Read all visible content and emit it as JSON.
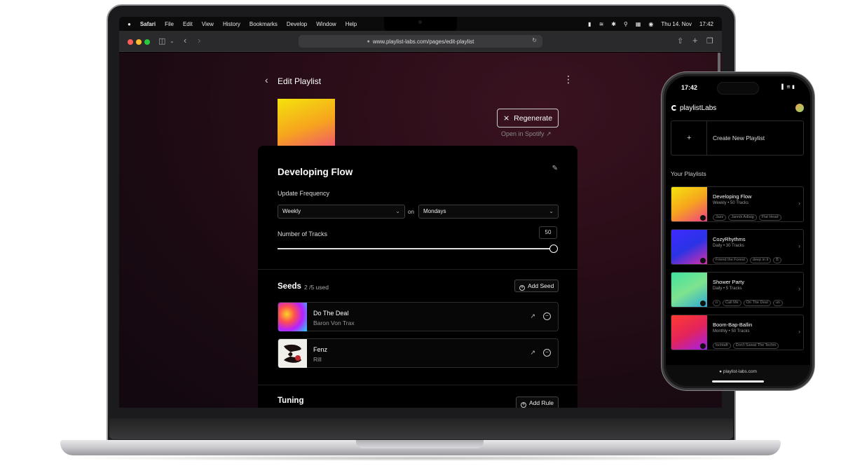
{
  "menubar": {
    "apple": "",
    "app": "Safari",
    "items": [
      "File",
      "Edit",
      "View",
      "History",
      "Bookmarks",
      "Develop",
      "Window",
      "Help"
    ],
    "status_icons": [
      "battery-icon",
      "wifi-icon",
      "bluetooth-icon",
      "search-icon",
      "control-center-icon",
      "siri-icon"
    ],
    "date": "Thu 14. Nov",
    "time": "17:42"
  },
  "browser": {
    "url": "www.playlist-labs.com/pages/edit-playlist"
  },
  "page": {
    "title": "Edit Playlist",
    "regenerate_label": "Regenerate",
    "open_spotify_label": "Open in Spotify",
    "playlist_name": "Developing Flow",
    "update_frequency_label": "Update Frequency",
    "frequency_value": "Weekly",
    "on_label": "on",
    "day_value": "Mondays",
    "tracks_label": "Number of Tracks",
    "tracks_value": "50",
    "tracks_fraction": 1.0,
    "seeds_title": "Seeds",
    "seeds_used": "2 /5 used",
    "add_seed_label": "Add Seed",
    "seeds": [
      {
        "title": "Do The Deal",
        "artist": "Baron Von Trax"
      },
      {
        "title": "Fenz",
        "artist": "Rill"
      }
    ],
    "tuning_title": "Tuning",
    "add_rule_label": "Add Rule"
  },
  "phone": {
    "time": "17:42",
    "brand": "playlistLabs",
    "create_label": "Create New Playlist",
    "create_plus": "+",
    "your_playlists_label": "Your Playlists",
    "playlists": [
      {
        "name": "Developing Flow",
        "meta": "Weekly • 50 Tracks",
        "tags": [
          "Jazz",
          "Jannik Adlaig",
          "Flat Head"
        ]
      },
      {
        "name": "CozyRhythms",
        "meta": "Daily • 30 Tracks",
        "tags": [
          "Friend the Forest",
          "deep in it",
          "B"
        ]
      },
      {
        "name": "Shower Party",
        "meta": "Daily • 5 Tracks",
        "tags": [
          "n",
          "Call Me",
          "On The Deal",
          "un"
        ]
      },
      {
        "name": "Boom-Bap-Ballin",
        "meta": "Monthly • 50 Tracks",
        "tags": [
          "lochtaft",
          "Don't Sweat The Techni"
        ]
      }
    ],
    "url": "playlist-labs.com"
  },
  "colors": {
    "page_bg": "#1a0a12",
    "cover_gradient": [
      "#f3e30c",
      "#f6a41e",
      "#ef3f86"
    ]
  }
}
